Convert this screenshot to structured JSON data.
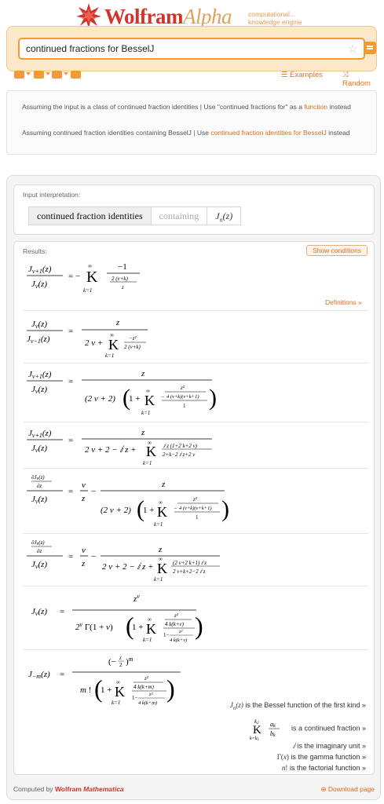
{
  "header": {
    "logo_main": "Wolfram",
    "logo_alpha": "Alpha",
    "tagline_line1": "computational...",
    "tagline_line2": "knowledge engine",
    "search_value": "continued fractions for BesselJ",
    "examples_label": "Examples",
    "random_label": "Random"
  },
  "assumptions": {
    "a1_text": "Assuming the input is a class of continued fraction identities | Use \"continued fractions for\" as a",
    "a1_link1": "a",
    "a1_link2": "function",
    "a1_tail": "instead",
    "a2_text": "Assuming continued fraction identities containing BesselJ | Use",
    "a2_link": "continued fraction identities for BesselJ",
    "a2_tail": "instead"
  },
  "input_pod": {
    "title": "Input interpretation:",
    "cells": [
      "continued fraction identities",
      "containing",
      "J_n(z)"
    ]
  },
  "results_pod": {
    "title": "Results:",
    "show_conditions": "Show conditions",
    "definitions_link": "Definitions »"
  },
  "footnotes": [
    "is the Bessel function of the first kind »",
    "is a continued fraction »",
    "is the imaginary unit »",
    "is the gamma function »",
    "is the factorial function »"
  ],
  "footer": {
    "computed_by": "Computed by",
    "brand": "Wolfram",
    "product": "Mathematica",
    "download": "Download page"
  },
  "colors": {
    "accent": "#f39a2c",
    "brand_red": "#d3342a",
    "link": "#e36a17"
  }
}
